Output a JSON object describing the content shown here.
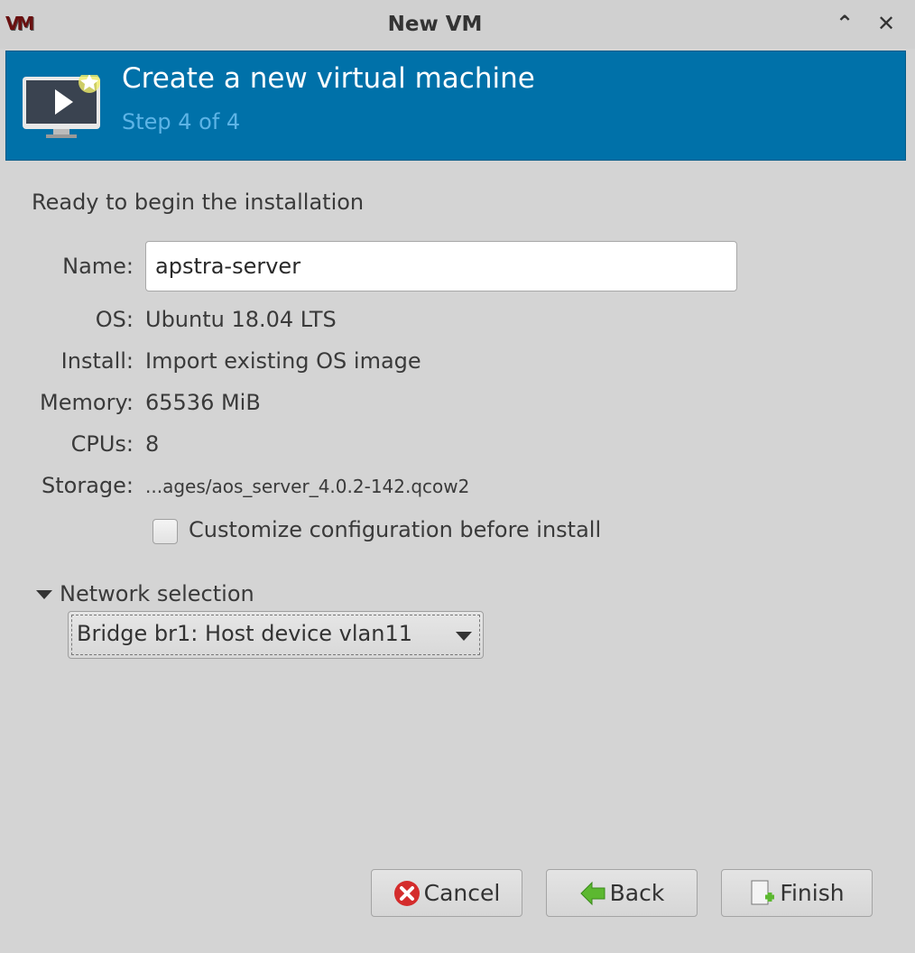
{
  "window": {
    "title": "New VM",
    "logo": "VM",
    "minimize_icon": "chevron-up-icon",
    "close_icon": "close-icon"
  },
  "banner": {
    "title": "Create a new virtual machine",
    "step": "Step 4 of 4"
  },
  "summary": {
    "heading": "Ready to begin the installation",
    "name_label": "Name:",
    "name_value": "apstra-server",
    "os_label": "OS:",
    "os_value": "Ubuntu 18.04 LTS",
    "install_label": "Install:",
    "install_value": "Import existing OS image",
    "memory_label": "Memory:",
    "memory_value": "65536 MiB",
    "cpus_label": "CPUs:",
    "cpus_value": "8",
    "storage_label": "Storage:",
    "storage_value": "...ages/aos_server_4.0.2-142.qcow2"
  },
  "customize": {
    "label": "Customize configuration before install",
    "checked": false
  },
  "network": {
    "expander_label": "Network selection",
    "selected": "Bridge br1: Host device vlan11"
  },
  "buttons": {
    "cancel": "Cancel",
    "back": "Back",
    "finish": "Finish"
  }
}
